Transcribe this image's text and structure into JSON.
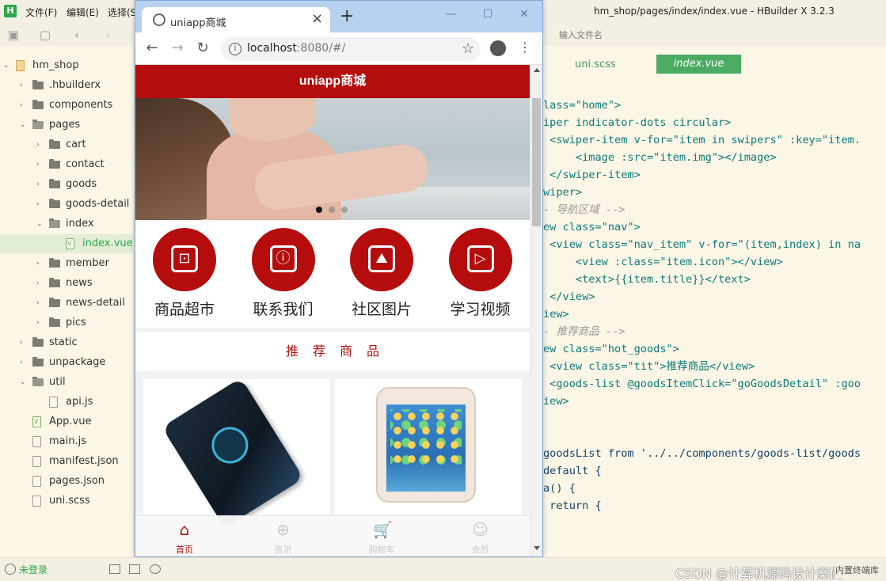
{
  "ide": {
    "logo": "H",
    "menus": [
      "文件(F)",
      "编辑(E)",
      "选择(S"
    ],
    "window_title": "hm_shop/pages/index/index.vue - HBuilder X 3.2.3",
    "file_search_placeholder": "输入文件名",
    "tabs": {
      "inactive": "uni.scss",
      "active": "index.vue"
    }
  },
  "tree": [
    {
      "label": "hm_shop",
      "kind": "project",
      "depth": 0,
      "arrow": "open"
    },
    {
      "label": ".hbuilderx",
      "kind": "folder",
      "depth": 1,
      "arrow": "closed"
    },
    {
      "label": "components",
      "kind": "folder",
      "depth": 1,
      "arrow": "closed"
    },
    {
      "label": "pages",
      "kind": "folder-open",
      "depth": 1,
      "arrow": "open"
    },
    {
      "label": "cart",
      "kind": "folder",
      "depth": 2,
      "arrow": "closed"
    },
    {
      "label": "contact",
      "kind": "folder",
      "depth": 2,
      "arrow": "closed"
    },
    {
      "label": "goods",
      "kind": "folder",
      "depth": 2,
      "arrow": "closed"
    },
    {
      "label": "goods-detail",
      "kind": "folder",
      "depth": 2,
      "arrow": "closed"
    },
    {
      "label": "index",
      "kind": "folder-open",
      "depth": 2,
      "arrow": "open"
    },
    {
      "label": "index.vue",
      "kind": "vue",
      "depth": 3,
      "arrow": "none",
      "selected": true
    },
    {
      "label": "member",
      "kind": "folder",
      "depth": 2,
      "arrow": "closed"
    },
    {
      "label": "news",
      "kind": "folder",
      "depth": 2,
      "arrow": "closed"
    },
    {
      "label": "news-detail",
      "kind": "folder",
      "depth": 2,
      "arrow": "closed"
    },
    {
      "label": "pics",
      "kind": "folder",
      "depth": 2,
      "arrow": "closed"
    },
    {
      "label": "static",
      "kind": "folder",
      "depth": 1,
      "arrow": "closed"
    },
    {
      "label": "unpackage",
      "kind": "folder",
      "depth": 1,
      "arrow": "closed"
    },
    {
      "label": "util",
      "kind": "folder-open",
      "depth": 1,
      "arrow": "open"
    },
    {
      "label": "api.js",
      "kind": "file",
      "depth": 2,
      "arrow": "none"
    },
    {
      "label": "App.vue",
      "kind": "vue",
      "depth": 1,
      "arrow": "none"
    },
    {
      "label": "main.js",
      "kind": "file",
      "depth": 1,
      "arrow": "none"
    },
    {
      "label": "manifest.json",
      "kind": "file",
      "depth": 1,
      "arrow": "none"
    },
    {
      "label": "pages.json",
      "kind": "file",
      "depth": 1,
      "arrow": "none"
    },
    {
      "label": "uni.scss",
      "kind": "file",
      "depth": 1,
      "arrow": "none"
    }
  ],
  "code": [
    {
      "text": "lass=\"home\">",
      "style": "tag"
    },
    {
      "text": "iper indicator-dots circular>",
      "style": "tag"
    },
    {
      "text": " <swiper-item v-for=\"item in swipers\" :key=\"item.",
      "style": "tag"
    },
    {
      "text": "     <image :src=\"item.img\"></image>",
      "style": "tag"
    },
    {
      "text": " </swiper-item>",
      "style": "tag"
    },
    {
      "text": "wiper>",
      "style": "tag"
    },
    {
      "text": "- 导航区域 -->",
      "style": "comment"
    },
    {
      "text": "ew class=\"nav\">",
      "style": "tag"
    },
    {
      "text": " <view class=\"nav_item\" v-for=\"(item,index) in na",
      "style": "tag"
    },
    {
      "text": "     <view :class=\"item.icon\"></view>",
      "style": "tag"
    },
    {
      "text": "     <text>{{item.title}}</text>",
      "style": "tag"
    },
    {
      "text": " </view>",
      "style": "tag"
    },
    {
      "text": "iew>",
      "style": "tag"
    },
    {
      "text": "- 推荐商品 -->",
      "style": "comment"
    },
    {
      "text": "ew class=\"hot_goods\">",
      "style": "tag"
    },
    {
      "text": " <view class=\"tit\">推荐商品</view>",
      "style": "tag"
    },
    {
      "text": " <goods-list @goodsItemClick=\"goGoodsDetail\" :goo",
      "style": "tag"
    },
    {
      "text": "iew>",
      "style": "tag"
    },
    {
      "text": "",
      "style": "tag"
    },
    {
      "text": "",
      "style": "tag"
    },
    {
      "text": "goodsList from '../../components/goods-list/goods",
      "style": "plain"
    },
    {
      "text": "default {",
      "style": "plain"
    },
    {
      "text": "a() {",
      "style": "plain"
    },
    {
      "text": " return {",
      "style": "plain"
    }
  ],
  "browser": {
    "tab_title": "uniapp商城",
    "url_host": "localhost",
    "url_rest": ":8080/#/",
    "window_buttons": [
      "—",
      "☐",
      "✕"
    ]
  },
  "app": {
    "header_title": "uniapp商城",
    "nav_items": [
      {
        "label": "商品超市",
        "icon": "store-icon",
        "glyph": "⊡"
      },
      {
        "label": "联系我们",
        "icon": "contact-icon",
        "glyph": "ⓘ"
      },
      {
        "label": "社区图片",
        "icon": "picture-icon",
        "glyph": "⛰"
      },
      {
        "label": "学习视频",
        "icon": "video-icon",
        "glyph": "▷"
      }
    ],
    "hot_goods_title": "推荐商品",
    "tabbar": [
      {
        "label": "首页",
        "icon": "home-icon",
        "glyph": "⌂",
        "active": true
      },
      {
        "label": "资讯",
        "icon": "globe-icon",
        "glyph": "⊕",
        "active": false
      },
      {
        "label": "购物车",
        "icon": "cart-icon",
        "glyph": "🛒",
        "active": false
      },
      {
        "label": "会员",
        "icon": "member-icon",
        "glyph": "☺",
        "active": false
      }
    ],
    "swiper_active_index": 0,
    "swiper_count": 3
  },
  "status": {
    "login": "未登录",
    "watermark": "CSDN @计算机源码设计案例",
    "corner_text": "内置终端库"
  },
  "colors": {
    "brand": "#b50d0d",
    "ide_green": "#2ca84a"
  }
}
